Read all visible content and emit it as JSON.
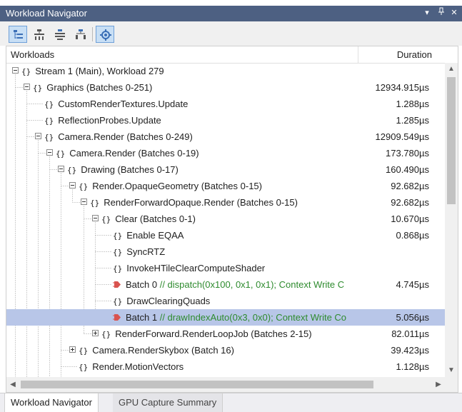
{
  "window": {
    "title": "Workload Navigator",
    "buttons": [
      "▾",
      "🖈",
      "✕"
    ]
  },
  "toolbar": {
    "tools": [
      "tree-view-icon",
      "collapse-icon",
      "expand-all-icon",
      "group-icon",
      "settings-gear-icon"
    ]
  },
  "grid": {
    "col_workloads": "Workloads",
    "col_duration": "Duration",
    "rows": [
      {
        "depth": 0,
        "toggle": "minus",
        "icon": "braces",
        "name": "Stream 1 (Main), Workload 279",
        "comment": "",
        "duration": ""
      },
      {
        "depth": 1,
        "toggle": "minus",
        "icon": "braces",
        "name": "Graphics (Batches 0-251)",
        "comment": "",
        "duration": "12934.915µs"
      },
      {
        "depth": 2,
        "toggle": "none",
        "icon": "braces",
        "name": "CustomRenderTextures.Update",
        "comment": "",
        "duration": "1.288µs"
      },
      {
        "depth": 2,
        "toggle": "none",
        "icon": "braces",
        "name": "ReflectionProbes.Update",
        "comment": "",
        "duration": "1.285µs"
      },
      {
        "depth": 2,
        "toggle": "minus",
        "icon": "braces",
        "name": "Camera.Render (Batches 0-249)",
        "comment": "",
        "duration": "12909.549µs"
      },
      {
        "depth": 3,
        "toggle": "minus",
        "icon": "braces",
        "name": "Camera.Render (Batches 0-19)",
        "comment": "",
        "duration": "173.780µs"
      },
      {
        "depth": 4,
        "toggle": "minus",
        "icon": "braces",
        "name": "Drawing (Batches 0-17)",
        "comment": "",
        "duration": "160.490µs"
      },
      {
        "depth": 5,
        "toggle": "minus",
        "icon": "braces",
        "name": "Render.OpaqueGeometry (Batches 0-15)",
        "comment": "",
        "duration": "92.682µs"
      },
      {
        "depth": 6,
        "toggle": "minus",
        "icon": "braces",
        "name": "RenderForwardOpaque.Render (Batches 0-15)",
        "comment": "",
        "duration": "92.682µs"
      },
      {
        "depth": 7,
        "toggle": "minus",
        "icon": "braces",
        "name": "Clear (Batches 0-1)",
        "comment": "",
        "duration": "10.670µs"
      },
      {
        "depth": 8,
        "toggle": "none",
        "icon": "braces",
        "name": "Enable EQAA",
        "comment": "",
        "duration": "0.868µs"
      },
      {
        "depth": 8,
        "toggle": "none",
        "icon": "braces",
        "name": "SyncRTZ",
        "comment": "",
        "duration": ""
      },
      {
        "depth": 8,
        "toggle": "none",
        "icon": "braces",
        "name": "InvokeHTileClearComputeShader",
        "comment": "",
        "duration": ""
      },
      {
        "depth": 8,
        "toggle": "none",
        "icon": "batch",
        "name": "Batch 0",
        "comment": "// dispatch(0x100, 0x1, 0x1); Context Write C",
        "duration": "4.745µs"
      },
      {
        "depth": 8,
        "toggle": "none",
        "icon": "braces",
        "name": "DrawClearingQuads",
        "comment": "",
        "duration": ""
      },
      {
        "depth": 8,
        "toggle": "none",
        "icon": "batch",
        "name": "Batch 1",
        "comment": "// drawIndexAuto(0x3, 0x0); Context Write Co",
        "duration": "5.056µs",
        "selected": true
      },
      {
        "depth": 7,
        "toggle": "plus",
        "icon": "braces",
        "name": "RenderForward.RenderLoopJob (Batches 2-15)",
        "comment": "",
        "duration": "82.011µs"
      },
      {
        "depth": 5,
        "toggle": "plus",
        "icon": "braces",
        "name": "Camera.RenderSkybox (Batch 16)",
        "comment": "",
        "duration": "39.423µs"
      },
      {
        "depth": 5,
        "toggle": "none",
        "icon": "braces",
        "name": "Render.MotionVectors",
        "comment": "",
        "duration": "1.128µs"
      }
    ]
  },
  "tabs": [
    "Workload Navigator",
    "GPU Capture Summary"
  ],
  "colors": {
    "titlebar": "#4d6082",
    "selection": "#b8c6e8",
    "comment": "#2e8b2e"
  }
}
